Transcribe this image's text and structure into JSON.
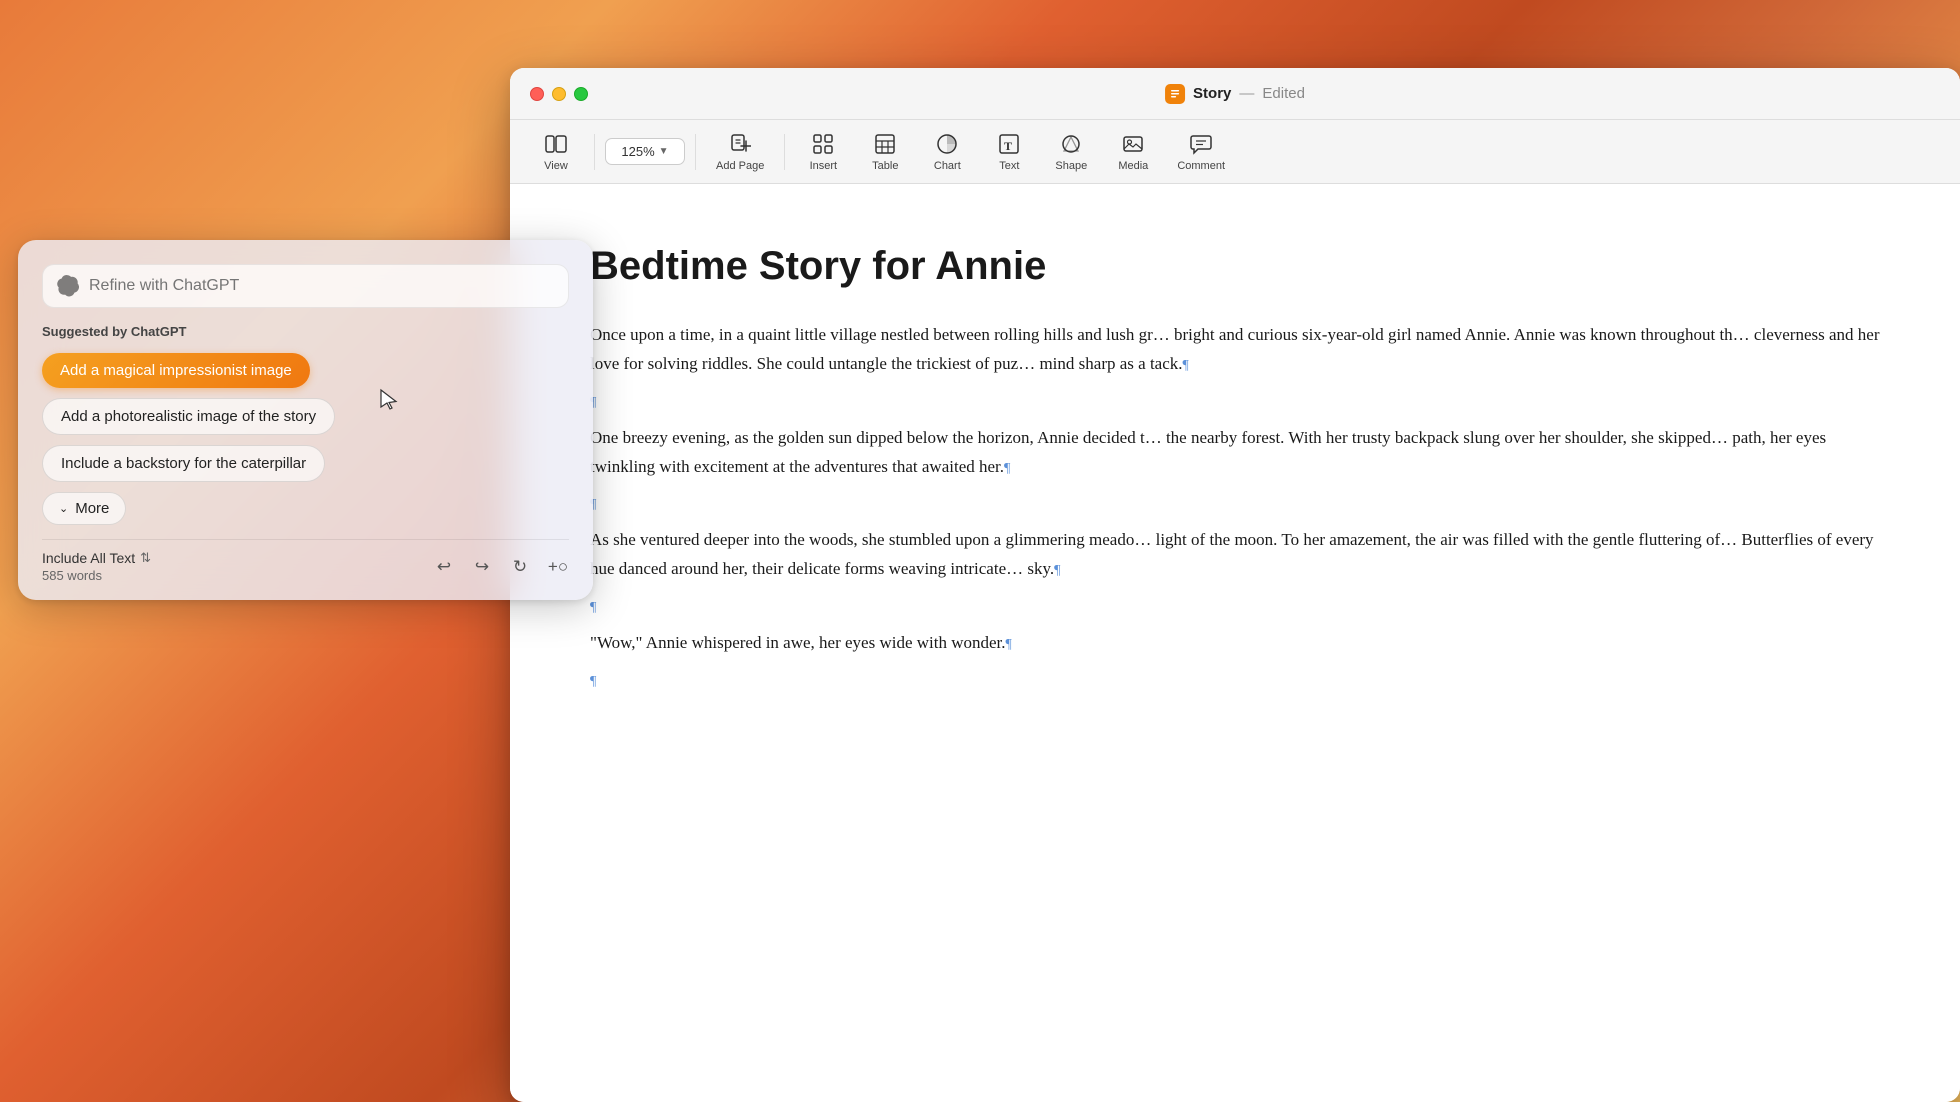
{
  "desktop": {
    "bg_desc": "macOS Sonoma gradient desktop background"
  },
  "chatgpt_panel": {
    "refine_placeholder": "Refine with ChatGPT",
    "suggested_label": "Suggested by ChatGPT",
    "suggestions": [
      {
        "id": "magical-image",
        "label": "Add a magical impressionist image",
        "highlighted": true
      },
      {
        "id": "photorealistic-image",
        "label": "Add a photorealistic image of the story",
        "highlighted": false
      },
      {
        "id": "backstory-caterpillar",
        "label": "Include a backstory for the caterpillar",
        "highlighted": false
      }
    ],
    "more_button": "More",
    "footer": {
      "include_label": "Include All Text",
      "word_count": "585 words"
    }
  },
  "window": {
    "title": "Story",
    "separator": "—",
    "status": "Edited"
  },
  "toolbar": {
    "zoom": "125%",
    "items": [
      {
        "id": "view",
        "label": "View",
        "icon": "view"
      },
      {
        "id": "zoom",
        "label": "Zoom",
        "icon": "zoom"
      },
      {
        "id": "add-page",
        "label": "Add Page",
        "icon": "add-page"
      },
      {
        "id": "insert",
        "label": "Insert",
        "icon": "insert"
      },
      {
        "id": "table",
        "label": "Table",
        "icon": "table"
      },
      {
        "id": "chart",
        "label": "Chart",
        "icon": "chart"
      },
      {
        "id": "text",
        "label": "Text",
        "icon": "text"
      },
      {
        "id": "shape",
        "label": "Shape",
        "icon": "shape"
      },
      {
        "id": "media",
        "label": "Media",
        "icon": "media"
      },
      {
        "id": "comment",
        "label": "Comment",
        "icon": "comment"
      }
    ]
  },
  "document": {
    "title": "Bedtime Story for Annie",
    "paragraphs": [
      "Once upon a time, in a quaint little village nestled between rolling hills and lush gr… bright and curious six-year-old girl named Annie. Annie was known throughout th… cleverness and her love for solving riddles. She could untangle the trickiest of puz… mind sharp as a tack.¶",
      "¶",
      "One breezy evening, as the golden sun dipped below the horizon, Annie decided t… the nearby forest. With her trusty backpack slung over her shoulder, she skipped… path, her eyes twinkling with excitement at the adventures that awaited her.¶",
      "¶",
      "As she ventured deeper into the woods, she stumbled upon a glimmering meado… light of the moon. To her amazement, the air was filled with the gentle fluttering of… Butterflies of every hue danced around her, their delicate forms weaving intricate… sky.¶",
      "¶",
      "\"Wow,\" Annie whispered in awe, her eyes wide with wonder.¶",
      "¶"
    ]
  }
}
